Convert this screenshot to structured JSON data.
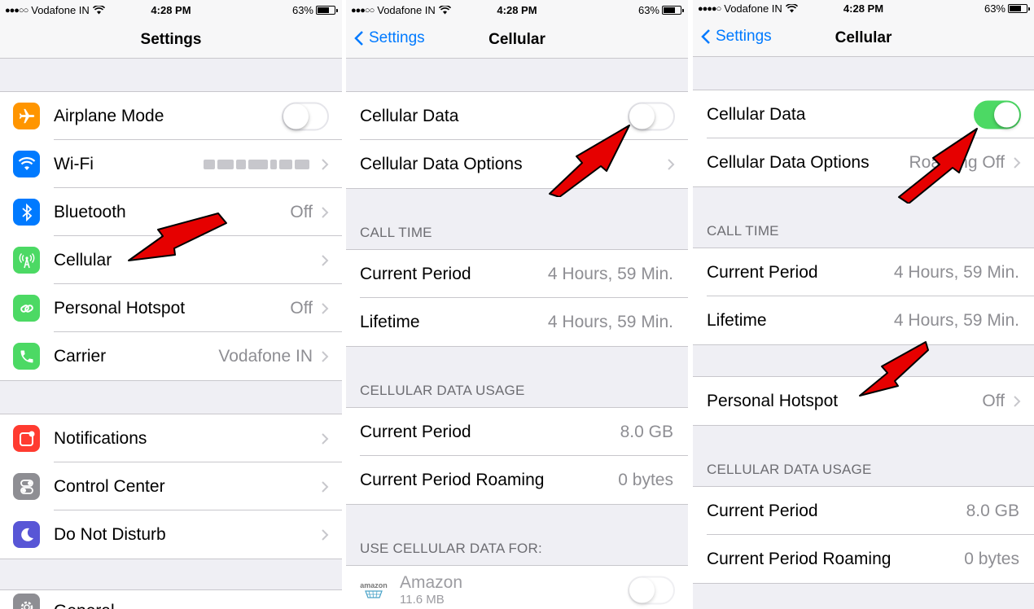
{
  "status": {
    "carrier": "Vodafone IN",
    "time": "4:28 PM",
    "battery": "63%",
    "battery_level": 0.63
  },
  "panel1": {
    "title": "Settings",
    "group1": [
      {
        "label": "Airplane Mode",
        "icon": "airplane-icon",
        "color": "#ff9500",
        "toggle": false
      },
      {
        "label": "Wi-Fi",
        "icon": "wifi-icon",
        "color": "#007aff",
        "value": ""
      },
      {
        "label": "Bluetooth",
        "icon": "bluetooth-icon",
        "color": "#007aff",
        "value": "Off"
      },
      {
        "label": "Cellular",
        "icon": "cellular-icon",
        "color": "#4cd964",
        "value": ""
      },
      {
        "label": "Personal Hotspot",
        "icon": "hotspot-icon",
        "color": "#4cd964",
        "value": "Off"
      },
      {
        "label": "Carrier",
        "icon": "phone-icon",
        "color": "#4cd964",
        "value": "Vodafone IN"
      }
    ],
    "group2": [
      {
        "label": "Notifications",
        "icon": "notifications-icon",
        "color": "#ff3b30"
      },
      {
        "label": "Control Center",
        "icon": "control-center-icon",
        "color": "#8e8e93"
      },
      {
        "label": "Do Not Disturb",
        "icon": "moon-icon",
        "color": "#5856d6"
      }
    ],
    "partial_label": "General"
  },
  "panel2": {
    "back": "Settings",
    "title": "Cellular",
    "cellular_data": {
      "label": "Cellular Data",
      "toggle": false
    },
    "cellular_data_options": {
      "label": "Cellular Data Options"
    },
    "call_time_header": "CALL TIME",
    "call_time": [
      {
        "label": "Current Period",
        "value": "4 Hours, 59 Min."
      },
      {
        "label": "Lifetime",
        "value": "4 Hours, 59 Min."
      }
    ],
    "usage_header": "CELLULAR DATA USAGE",
    "usage": [
      {
        "label": "Current Period",
        "value": "8.0 GB"
      },
      {
        "label": "Current Period Roaming",
        "value": "0 bytes"
      }
    ],
    "use_for_header": "USE CELLULAR DATA FOR:",
    "app": {
      "name": "Amazon",
      "size": "11.6 MB",
      "icon_text": "amazon",
      "toggle": false
    }
  },
  "panel3": {
    "back": "Settings",
    "title": "Cellular",
    "cellular_data": {
      "label": "Cellular Data",
      "toggle": true
    },
    "cellular_data_options": {
      "label": "Cellular Data Options",
      "value": "Roaming Off"
    },
    "call_time_header": "CALL TIME",
    "call_time": [
      {
        "label": "Current Period",
        "value": "4 Hours, 59 Min."
      },
      {
        "label": "Lifetime",
        "value": "4 Hours, 59 Min."
      }
    ],
    "hotspot": {
      "label": "Personal Hotspot",
      "value": "Off"
    },
    "usage_header": "CELLULAR DATA USAGE",
    "usage": [
      {
        "label": "Current Period",
        "value": "8.0 GB"
      },
      {
        "label": "Current Period Roaming",
        "value": "0 bytes"
      }
    ]
  },
  "colors": {
    "accent": "#007aff",
    "toggle_on": "#4cd964",
    "annotation_arrow": "#e00000"
  }
}
